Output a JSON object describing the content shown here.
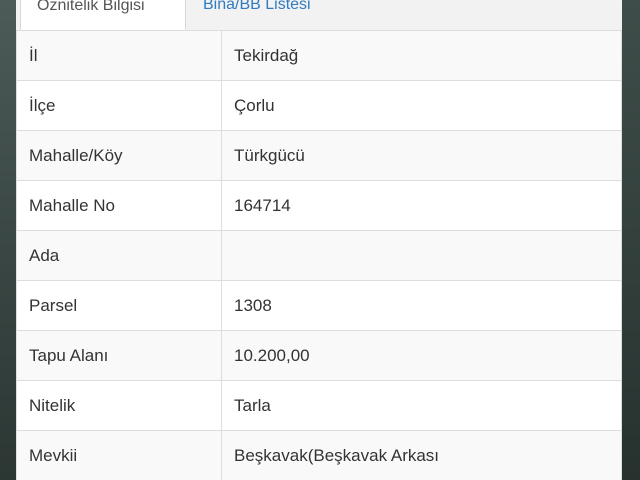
{
  "tabs": [
    {
      "label": "Öznitelik Bilgisi",
      "active": true
    },
    {
      "label": "Bina/BB Listesi",
      "active": false
    }
  ],
  "rows": [
    {
      "key": "İl",
      "value": "Tekirdağ"
    },
    {
      "key": "İlçe",
      "value": "Çorlu"
    },
    {
      "key": "Mahalle/Köy",
      "value": "Türkgücü"
    },
    {
      "key": "Mahalle No",
      "value": "164714"
    },
    {
      "key": "Ada",
      "value": ""
    },
    {
      "key": "Parsel",
      "value": "1308"
    },
    {
      "key": "Tapu Alanı",
      "value": "10.200,00"
    },
    {
      "key": "Nitelik",
      "value": "Tarla"
    },
    {
      "key": "Mevkii",
      "value": "Beşkavak(Beşkavak Arkası"
    }
  ],
  "colors": {
    "link": "#2f7cc1",
    "text": "#333333",
    "border": "#dddddd",
    "stripe": "#f9f9f9"
  }
}
